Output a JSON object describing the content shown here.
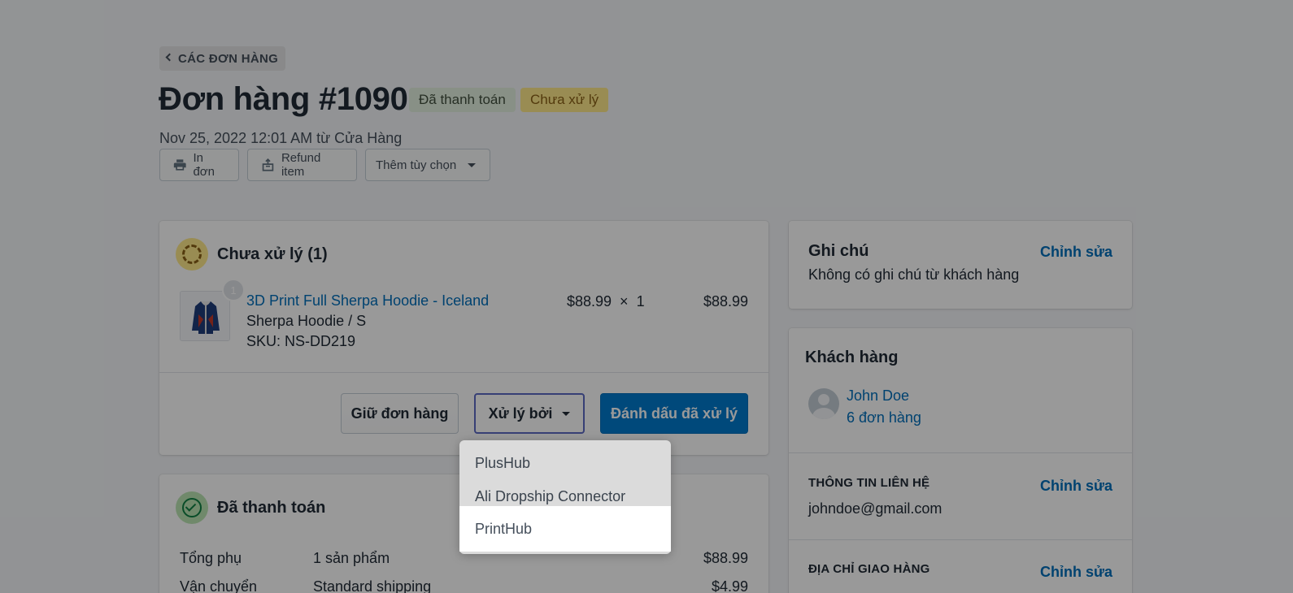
{
  "header": {
    "back_label": "CÁC ĐƠN HÀNG",
    "title": "Đơn hàng #1090",
    "badges": {
      "paid": "Đã thanh toán",
      "unfulfilled": "Chưa xử lý"
    },
    "subtitle": "Nov 25, 2022 12:01 AM từ Cửa Hàng",
    "actions": {
      "print": "In đơn",
      "refund": "Refund item",
      "more": "Thêm tùy chọn"
    }
  },
  "unfulfilled": {
    "title": "Chưa xử lý (1)",
    "item": {
      "quantity_badge": "1",
      "name": "3D Print Full Sherpa Hoodie - Iceland",
      "variant": "Sherpa Hoodie / S",
      "sku": "SKU: NS-DD219",
      "price_qty": "$88.99  ×  1",
      "total": "$88.99"
    },
    "buttons": {
      "hold": "Giữ đơn hàng",
      "fulfilled_by": "Xử lý bởi",
      "mark_fulfilled": "Đánh dấu đã xử lý"
    }
  },
  "paid": {
    "title": "Đã thanh toán",
    "rows": [
      {
        "label": "Tổng phụ",
        "detail": "1 sản phẩm",
        "amount": "$88.99"
      },
      {
        "label": "Vận chuyển",
        "detail": "Standard shipping",
        "amount": "$4.99"
      }
    ]
  },
  "notes": {
    "title": "Ghi chú",
    "edit": "Chỉnh sửa",
    "text": "Không có ghi chú từ khách hàng"
  },
  "customer": {
    "title": "Khách hàng",
    "name": "John Doe",
    "orders": "6 đơn hàng",
    "contact_heading": "THÔNG TIN LIÊN HỆ",
    "contact_edit": "Chỉnh sửa",
    "email": "johndoe@gmail.com",
    "shipping_heading": "ĐỊA CHỈ GIAO HÀNG",
    "shipping_edit": "Chỉnh sửa"
  },
  "dropdown": {
    "items": [
      "PlusHub",
      "Ali Dropship Connector",
      "PrintHub"
    ]
  },
  "colors": {
    "link": "#006fbb",
    "primary": "#007ace",
    "paid_badge": "#e3f1df",
    "unfulfilled_badge": "#ffea8a"
  },
  "icons": [
    "chevron-left-icon",
    "printer-icon",
    "refund-icon",
    "caret-down-icon",
    "unfulfilled-status-icon",
    "paid-check-icon",
    "avatar-icon"
  ]
}
